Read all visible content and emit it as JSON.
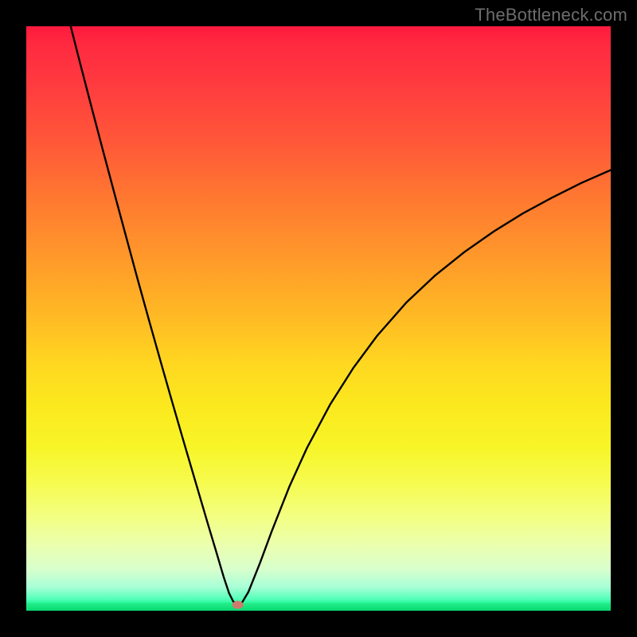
{
  "watermark": "TheBottleneck.com",
  "chart_data": {
    "type": "line",
    "title": "",
    "xlabel": "",
    "ylabel": "",
    "xlim": [
      0,
      100
    ],
    "ylim": [
      0,
      100
    ],
    "grid": false,
    "legend": false,
    "marker": {
      "x": 36.2,
      "y": 1.0,
      "color": "#cf7a6e"
    },
    "series": [
      {
        "name": "left-branch",
        "x": [
          7.6,
          9,
          11,
          13,
          15,
          17,
          19,
          21,
          23,
          25,
          27,
          29,
          31,
          32.5,
          33.8,
          34.7,
          35.4,
          36.0
        ],
        "y": [
          100,
          94.5,
          86.8,
          79.2,
          71.7,
          64.3,
          56.9,
          49.7,
          42.6,
          35.6,
          28.7,
          21.9,
          15.1,
          10.1,
          5.7,
          3.0,
          1.6,
          1.0
        ]
      },
      {
        "name": "right-branch",
        "x": [
          36.0,
          36.8,
          38,
          40,
          42,
          45,
          48,
          52,
          56,
          60,
          65,
          70,
          75,
          80,
          85,
          90,
          95,
          100
        ],
        "y": [
          1.0,
          1.2,
          3.2,
          8.2,
          13.6,
          21.2,
          27.8,
          35.3,
          41.6,
          47.0,
          52.7,
          57.4,
          61.4,
          64.9,
          68.0,
          70.7,
          73.2,
          75.4
        ]
      }
    ],
    "background_gradient": {
      "top": "#ff1a3c",
      "mid": "#ffd820",
      "bottom": "#06e174"
    }
  }
}
